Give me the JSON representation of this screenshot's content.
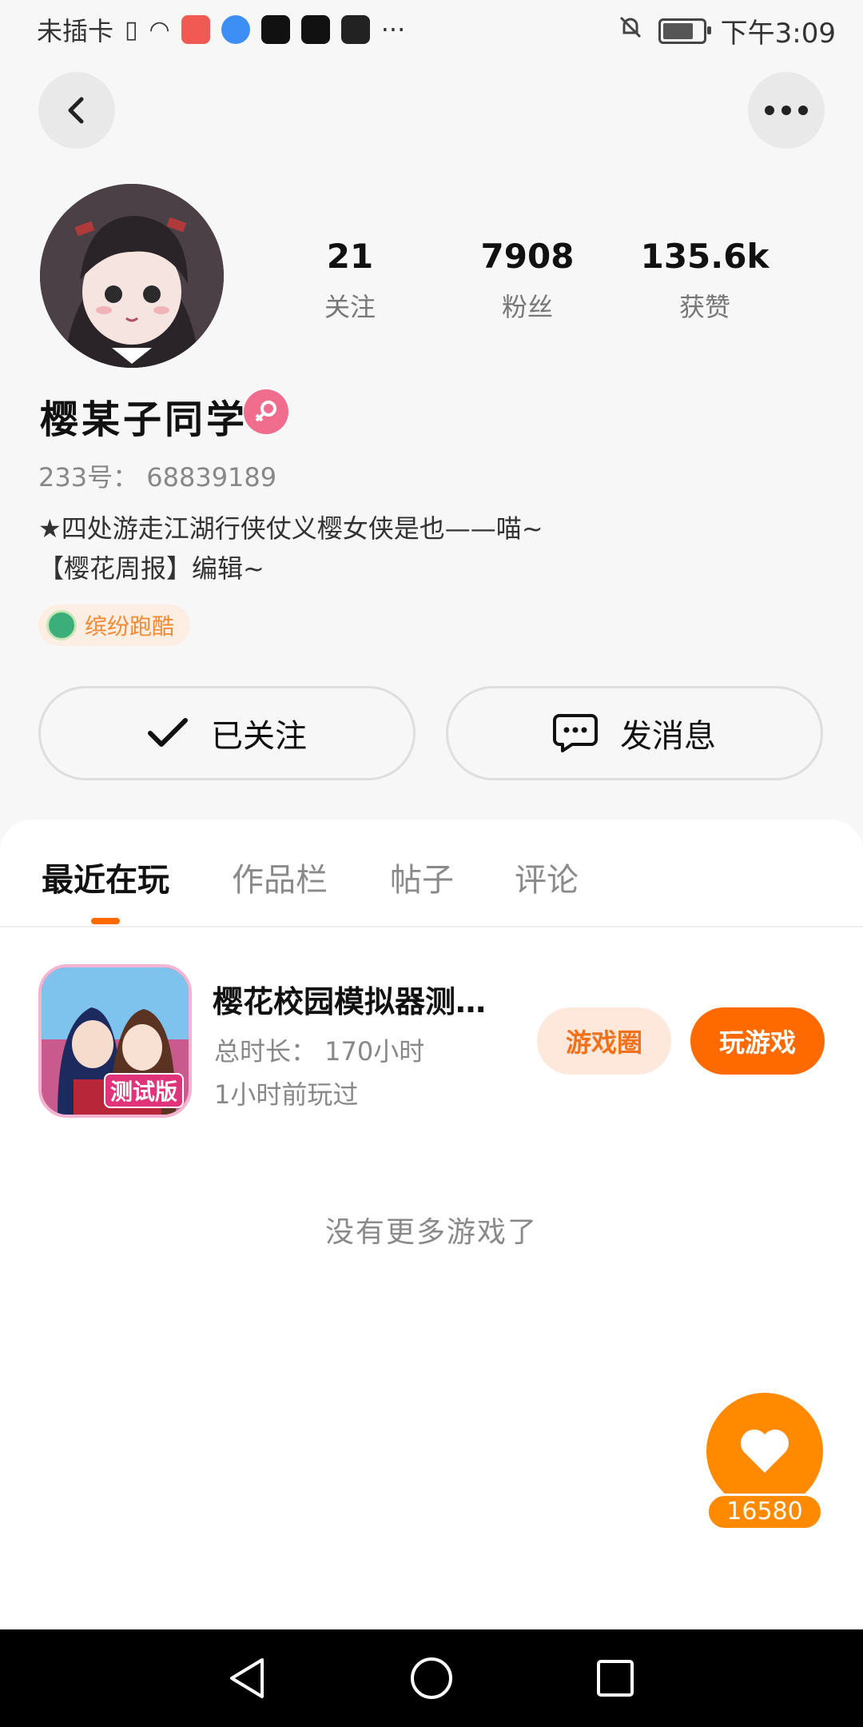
{
  "status_bar": {
    "carrier": "未插卡",
    "time": "下午3:09"
  },
  "header": {
    "back_icon": "chevron-left-icon",
    "more_icon": "more-dots-icon"
  },
  "profile": {
    "stats": [
      {
        "value": "21",
        "label": "关注"
      },
      {
        "value": "7908",
        "label": "粉丝"
      },
      {
        "value": "135.6k",
        "label": "获赞"
      }
    ],
    "name": "樱某子同学",
    "id_text": "233号：  68839189",
    "bio_line1": "★四处游走江湖行侠仗义樱女侠是也——喵~",
    "bio_line2": "【樱花周报】编辑~",
    "tag": "缤纷跑酷"
  },
  "actions": {
    "follow_label": "已关注",
    "message_label": "发消息"
  },
  "tabs": [
    {
      "label": "最近在玩",
      "active": true
    },
    {
      "label": "作品栏",
      "active": false
    },
    {
      "label": "帖子",
      "active": false
    },
    {
      "label": "评论",
      "active": false
    }
  ],
  "game": {
    "title": "樱花校园模拟器测…",
    "duration": "总时长：  170小时",
    "last_played": "1小时前玩过",
    "badge": "测试版",
    "circle_label": "游戏圈",
    "play_label": "玩游戏"
  },
  "empty_text": "没有更多游戏了",
  "like": {
    "count": "16580"
  },
  "colors": {
    "accent": "#ff6a00",
    "fab": "#ff8a00",
    "gender": "#f06d8e"
  }
}
